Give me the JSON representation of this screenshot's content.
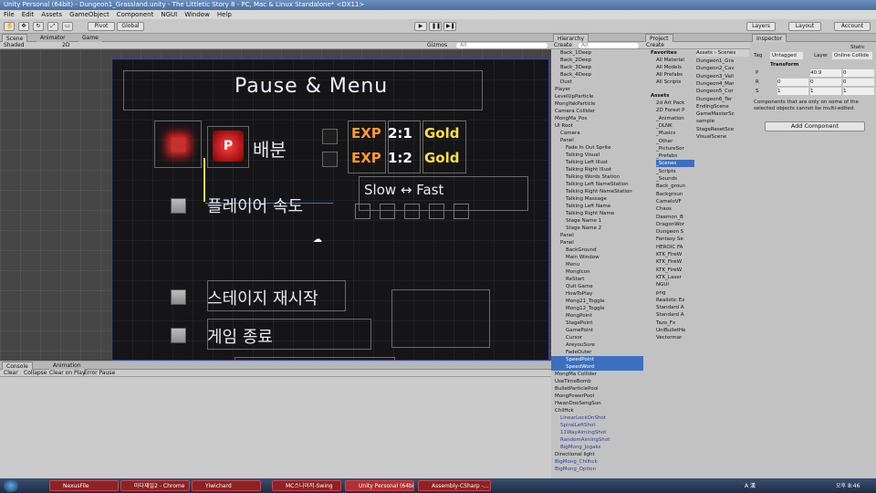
{
  "window": {
    "title": "Unity Personal (64bit) - Dungeon1_Grassland.unity - The Littletic Story 8 - PC, Mac & Linux Standalone* <DX11>"
  },
  "menu": [
    "File",
    "Edit",
    "Assets",
    "GameObject",
    "Component",
    "NGUI",
    "Window",
    "Help"
  ],
  "toolbar": {
    "pivot": "Pivot",
    "global": "Global",
    "layers": "Layers",
    "layout": "Layout",
    "account": "Account"
  },
  "scene": {
    "tabs": [
      "Scene",
      "Animator",
      "Game"
    ],
    "shading": "Shaded",
    "mode2d": "2D",
    "gizmos": "Gizmos",
    "search_placeholder": "All"
  },
  "game_ui": {
    "title": "Pause & Menu",
    "distribute": "배분",
    "exp1": "EXP",
    "ratio1": "2:1",
    "gold1": "Gold",
    "exp2": "EXP",
    "ratio2": "1:2",
    "gold2": "Gold",
    "speed_label": "플레이어 속도",
    "speed_range": "Slow ↔ Fast",
    "restart": "스테이지 재시작",
    "quit": "게임 종료",
    "icon_letter": "P"
  },
  "console": {
    "tabs": [
      "Console",
      "Animation"
    ],
    "buttons": [
      "Clear",
      "Collapse",
      "Clear on Play",
      "Error Pause"
    ]
  },
  "hierarchy": {
    "title": "Hierarchy",
    "create": "Create",
    "search": "All",
    "rows": [
      "Back_1Deep",
      "Back_2Deep",
      "Back_3Deep",
      "Back_4Deep",
      "Dust",
      "Player",
      "LevelUpParticle",
      "MongYakParticle",
      "Camera Collider",
      "MongMa_Pos",
      "UI Root",
      "Camera",
      "Panel",
      "Fade In Out Sprite",
      "Talking Visual",
      "Talking Left Illust",
      "Talking Right Illust",
      "Talking Words Station",
      "Talking Left NameStation",
      "Talking Right NameStation",
      "Talking Massage",
      "Talking Left Name",
      "Talking Right Name",
      "Stage Name 1",
      "Stage Name 2",
      "Panel",
      "Panel",
      "BackGround",
      "Main Window",
      "Menu",
      "MongIcon",
      "ReStart",
      "Quit Game",
      "HowToPlay",
      "Mong21_Toggle",
      "Mong12_Toggle",
      "MongPoint",
      "StagePoint",
      "GamePoint",
      "Cursor",
      "AreyouSure",
      "FadeOuter",
      "SpeedPoint",
      "SpeedWord",
      "MongMa Collider",
      "UseTimeBomb",
      "BulletParticlePool",
      "MongPowerPool",
      "HwanDooSengSun",
      "ChilHck",
      "LinearLockOnShot",
      "SpiralLeftShot",
      "11WayAimingShot",
      "RandomAimingShot",
      "BigMong_Jogaks",
      "Directional light",
      "BigMong_Chilhck",
      "BigMong_Option"
    ]
  },
  "project": {
    "title": "Project",
    "create": "Create",
    "favorites": "Favorites",
    "fav_items": [
      "All Material",
      "All Models",
      "All Prefabs",
      "All Scripts"
    ],
    "assets": "Assets",
    "folders": [
      "2d Art Pack",
      "2D Forest P",
      "_Animation",
      "_DLNK",
      "_Musics",
      "_Other",
      "_PictureSor",
      "_Prefabs",
      "_Scenes",
      "_Scripts",
      "_Sounds",
      "Back_groun",
      "Backgroun",
      "CameloVF",
      "Chaos",
      "Daemon_B",
      "DragonWor",
      "Dungeon S",
      "Fantasy Se",
      "HEROIC FA",
      "KTK_FireW",
      "KTK_FireW",
      "KTK_FireW",
      "KTK_Laser",
      "NGUI",
      "png",
      "Realistic Ex",
      "Standard A",
      "Standard A",
      "Tazo_Fx",
      "UniBulletHe",
      "Vectormar"
    ],
    "scenes_header": "Assets › Scenes",
    "scenes": [
      "Dungeon1_Gra",
      "Dungeon2_Cav",
      "Dungeon3_Vall",
      "Dungeon4_Mar",
      "Dungeon5_Cor",
      "Dungeon6_Ter",
      "EndingScene",
      "GameMasterSc",
      "sample",
      "StageResetSce",
      "VisualScene"
    ]
  },
  "inspector": {
    "title": "Inspector",
    "static": "Static",
    "tag": "Tag",
    "tag_val": "Untagged",
    "layer": "Layer",
    "layer_val": "Online Collide",
    "transform": "Transform",
    "P": "P",
    "R": "R",
    "S": "S",
    "px": "",
    "py": "40.9",
    "pz": "0",
    "rx": "0",
    "ry": "0",
    "rz": "0",
    "sx": "1",
    "sy": "1",
    "sz": "1",
    "note": "Components that are only on some of the selected objects cannot be multi-edited.",
    "add": "Add Component"
  },
  "taskbar": {
    "items": [
      "NexusFile",
      "마다재일2 - Chrome",
      "Yiwichard",
      "MC스니이저-Swing",
      "Unity Personal (64bi...",
      "Assembly-CSharp -..."
    ],
    "lang": "A 漢",
    "clock": "오후 8:46"
  }
}
